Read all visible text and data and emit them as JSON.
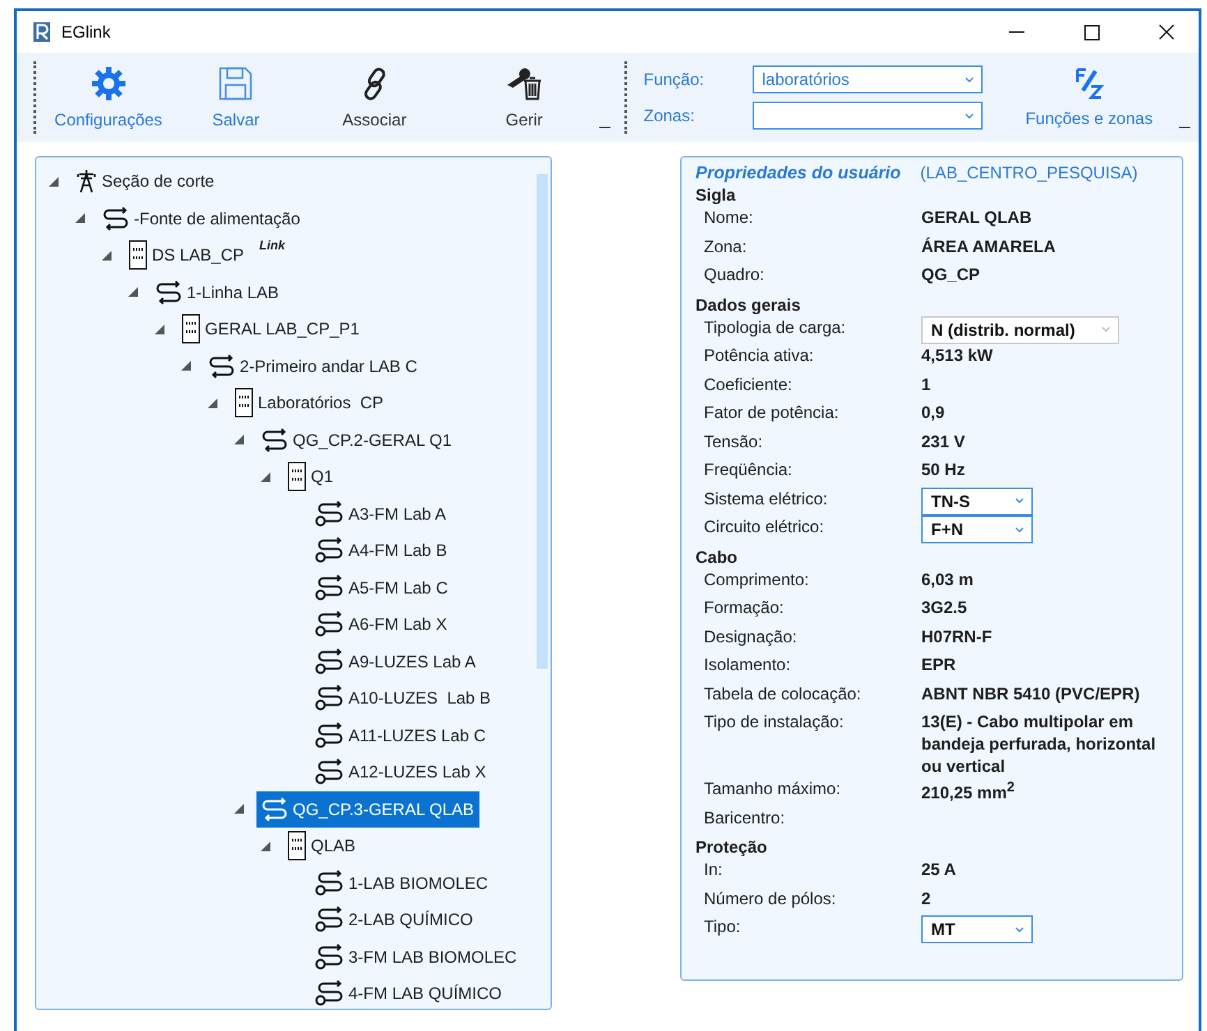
{
  "window": {
    "title": "EGlink"
  },
  "toolbar": {
    "buttons": [
      {
        "label": "Configurações",
        "kind": "gear",
        "highlighted": true
      },
      {
        "label": "Salvar",
        "kind": "save",
        "highlighted": true
      },
      {
        "label": "Associar",
        "kind": "link",
        "highlighted": false
      },
      {
        "label": "Gerir",
        "kind": "manage",
        "highlighted": false
      }
    ],
    "fields": [
      {
        "label": "Função:",
        "value": "laboratórios"
      },
      {
        "label": "Zonas:"
      }
    ],
    "function_button": {
      "label": "Funções e zonas"
    }
  },
  "tree": [
    {
      "label": "Seção de corte",
      "kind": "tower",
      "expanded": true,
      "selected": false,
      "children": [
        {
          "label": "-Fonte de alimentação",
          "kind": "circuit",
          "expanded": true,
          "selected": false,
          "children": [
            {
              "label": "DS LAB_CP",
              "kind": "panel",
              "badge": "Link",
              "expanded": true,
              "selected": false,
              "children": [
                {
                  "label": "1-Linha LAB",
                  "kind": "circuit",
                  "expanded": true,
                  "selected": false,
                  "children": [
                    {
                      "label": "GERAL LAB_CP_P1",
                      "kind": "panel",
                      "expanded": true,
                      "selected": false,
                      "children": [
                        {
                          "label": "2-Primeiro andar LAB C",
                          "kind": "circuit",
                          "expanded": true,
                          "selected": false,
                          "children": [
                            {
                              "label": "Laboratórios  CP",
                              "kind": "panel",
                              "expanded": true,
                              "selected": false,
                              "children": [
                                {
                                  "label": "QG_CP.2-GERAL Q1",
                                  "kind": "circuit",
                                  "expanded": true,
                                  "selected": false,
                                  "children": [
                                    {
                                      "label": "Q1",
                                      "kind": "panel",
                                      "expanded": true,
                                      "selected": false,
                                      "children": [
                                        {
                                          "label": "A3-FM Lab A",
                                          "kind": "load",
                                          "selected": false
                                        },
                                        {
                                          "label": "A4-FM Lab B",
                                          "kind": "load",
                                          "selected": false
                                        },
                                        {
                                          "label": "A5-FM Lab C",
                                          "kind": "load",
                                          "selected": false
                                        },
                                        {
                                          "label": "A6-FM Lab X",
                                          "kind": "load",
                                          "selected": false
                                        },
                                        {
                                          "label": "A9-LUZES Lab A",
                                          "kind": "load",
                                          "selected": false
                                        },
                                        {
                                          "label": "A10-LUZES  Lab B",
                                          "kind": "load",
                                          "selected": false
                                        },
                                        {
                                          "label": "A11-LUZES Lab C",
                                          "kind": "load",
                                          "selected": false
                                        },
                                        {
                                          "label": "A12-LUZES Lab X",
                                          "kind": "load",
                                          "selected": false
                                        }
                                      ]
                                    }
                                  ]
                                },
                                {
                                  "label": "QG_CP.3-GERAL QLAB",
                                  "kind": "circuit",
                                  "expanded": true,
                                  "selected": true,
                                  "children": [
                                    {
                                      "label": "QLAB",
                                      "kind": "panel",
                                      "expanded": true,
                                      "selected": false,
                                      "children": [
                                        {
                                          "label": "1-LAB BIOMOLEC",
                                          "kind": "load",
                                          "selected": false
                                        },
                                        {
                                          "label": "2-LAB QUÍMICO",
                                          "kind": "load",
                                          "selected": false
                                        },
                                        {
                                          "label": "3-FM LAB BIOMOLEC",
                                          "kind": "load",
                                          "selected": false
                                        },
                                        {
                                          "label": "4-FM LAB QUÍMICO",
                                          "kind": "load",
                                          "selected": false
                                        }
                                      ]
                                    }
                                  ]
                                }
                              ]
                            }
                          ]
                        }
                      ]
                    }
                  ]
                }
              ]
            }
          ]
        }
      ]
    }
  ],
  "properties": {
    "title": "Propriedades do usuário",
    "subtitle": "(LAB_CENTRO_PESQUISA)",
    "sections": [
      {
        "heading": "Sigla",
        "rows": [
          {
            "label": "Nome:",
            "value": "GERAL QLAB",
            "kind": "text"
          },
          {
            "label": "Zona:",
            "value": "ÁREA AMARELA",
            "kind": "text"
          },
          {
            "label": "Quadro:",
            "value": "QG_CP",
            "kind": "text"
          }
        ]
      },
      {
        "heading": "Dados gerais",
        "rows": [
          {
            "label": "Tipologia de carga:",
            "value": "N (distrib. normal)",
            "kind": "select",
            "disabled": true
          },
          {
            "label": "Potência ativa:",
            "value": "4,513 kW",
            "kind": "text"
          },
          {
            "label": "Coeficiente:",
            "value": "1",
            "kind": "text"
          },
          {
            "label": "Fator de potência:",
            "value": "0,9",
            "kind": "text"
          },
          {
            "label": "Tensão:",
            "value": "231 V",
            "kind": "text"
          },
          {
            "label": "Freqüência:",
            "value": "50 Hz",
            "kind": "text"
          },
          {
            "label": "Sistema elétrico:",
            "value": "TN-S",
            "kind": "select",
            "disabled": false
          },
          {
            "label": "Circuito elétrico:",
            "value": "F+N",
            "kind": "select",
            "disabled": false
          }
        ]
      },
      {
        "heading": "Cabo",
        "rows": [
          {
            "label": "Comprimento:",
            "value": "6,03 m",
            "kind": "text"
          },
          {
            "label": "Formação:",
            "value": "3G2.5",
            "kind": "text"
          },
          {
            "label": "Designação:",
            "value": "H07RN-F",
            "kind": "text"
          },
          {
            "label": "Isolamento:",
            "value": "EPR",
            "kind": "text"
          },
          {
            "label": "Tabela de colocação:",
            "value": "ABNT NBR 5410 (PVC/EPR)",
            "kind": "text"
          },
          {
            "label": "Tipo de instalação:",
            "value": "13(E) - Cabo multipolar em bandeja perfurada, horizontal ou vertical",
            "kind": "text"
          },
          {
            "label": "Tamanho máximo:",
            "value": "210,25 mm$^{2}$",
            "kind": "text"
          },
          {
            "label": "Baricentro:",
            "kind": "empty"
          }
        ]
      },
      {
        "heading": "Proteção",
        "rows": [
          {
            "label": "In:",
            "value": "25 A",
            "kind": "text"
          },
          {
            "label": "Número de pólos:",
            "value": "2",
            "kind": "text"
          },
          {
            "label": "Tipo:",
            "value": "MT",
            "kind": "select",
            "disabled": false
          }
        ]
      }
    ]
  }
}
